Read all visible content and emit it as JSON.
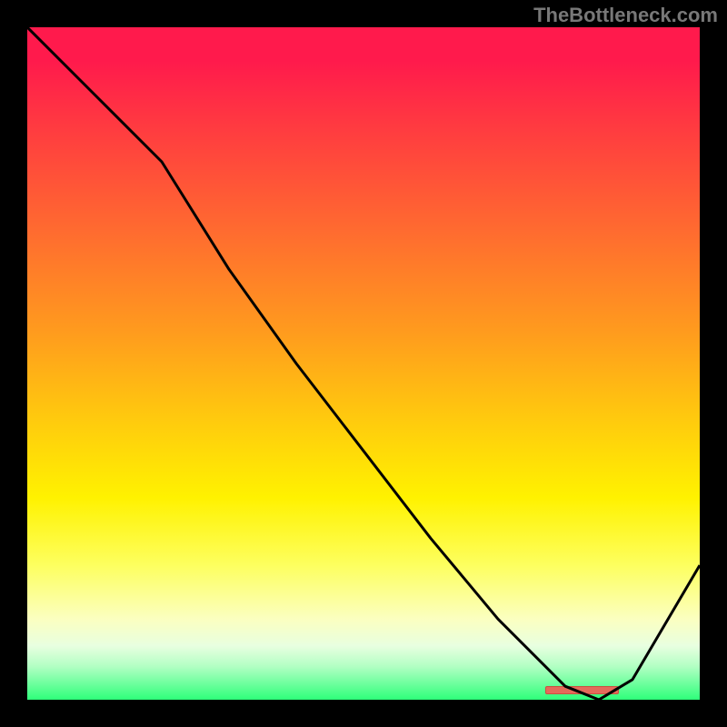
{
  "watermark": "TheBottleneck.com",
  "chart_data": {
    "type": "line",
    "title": "",
    "xlabel": "",
    "ylabel": "",
    "x_range": [
      0,
      100
    ],
    "y_range": [
      0,
      100
    ],
    "series": [
      {
        "name": "curve",
        "x": [
          0,
          10,
          20,
          30,
          40,
          50,
          60,
          70,
          80,
          85,
          90,
          100
        ],
        "y": [
          100,
          90,
          80,
          64,
          50,
          37,
          24,
          12,
          2,
          0,
          3,
          20
        ]
      }
    ],
    "marker": {
      "x_start": 77,
      "x_end": 88,
      "y": 0.5
    },
    "gradient_stops": [
      {
        "pos": 0,
        "color": "#ff1a4c"
      },
      {
        "pos": 45,
        "color": "#ff9a1e"
      },
      {
        "pos": 70,
        "color": "#fff200"
      },
      {
        "pos": 100,
        "color": "#2eff7a"
      }
    ]
  }
}
